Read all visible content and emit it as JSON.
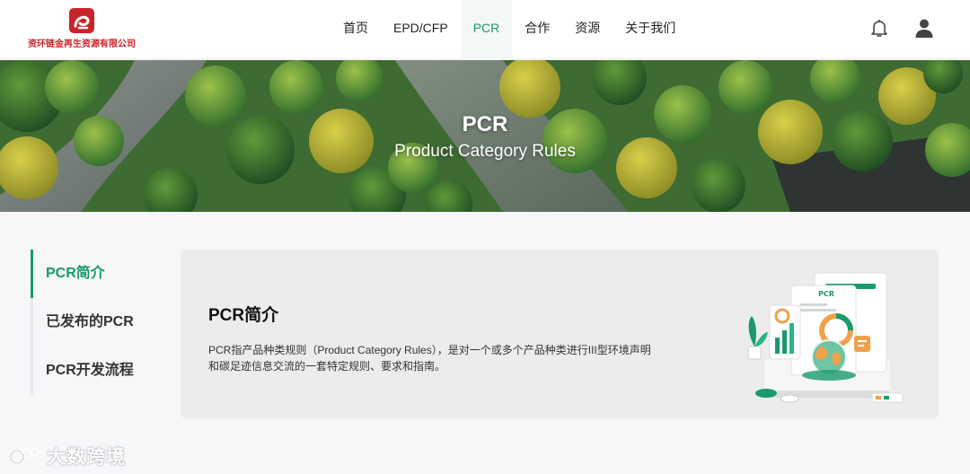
{
  "header": {
    "logo_text": "资环链金再生资源有限公司",
    "nav": [
      {
        "label": "首页"
      },
      {
        "label": "EPD/CFP"
      },
      {
        "label": "PCR"
      },
      {
        "label": "合作"
      },
      {
        "label": "资源"
      },
      {
        "label": "关于我们"
      }
    ],
    "active_nav": "PCR",
    "icons": [
      "bell-icon",
      "user-icon"
    ]
  },
  "banner": {
    "title": "PCR",
    "subtitle": "Product Category Rules"
  },
  "sidebar": {
    "items": [
      {
        "label": "PCR简介"
      },
      {
        "label": "已发布的PCR"
      },
      {
        "label": "PCR开发流程"
      }
    ],
    "active": "PCR简介"
  },
  "content": {
    "title": "PCR简介",
    "body": "PCR指产品种类规则（Product Category Rules），是对一个或多个产品种类进行III型环境声明和碳足迹信息交流的一套特定规则、要求和指南。"
  },
  "watermark": {
    "text": "大数跨境"
  },
  "colors": {
    "accent": "#1a9a6c",
    "brand_red": "#c8242b"
  }
}
